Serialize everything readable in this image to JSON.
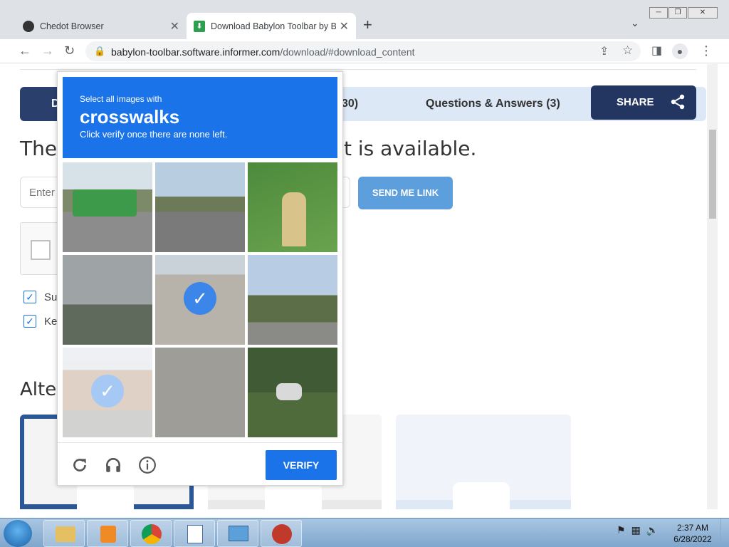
{
  "browser": {
    "tabs": [
      {
        "title": "Chedot Browser",
        "active": false
      },
      {
        "title": "Download Babylon Toolbar by Ba",
        "active": true
      }
    ],
    "url_host": "babylon-toolbar.software.informer.com",
    "url_path": "/download/#download_content"
  },
  "page": {
    "nav": {
      "left_label": "D",
      "reviews_label": "30)",
      "qa_label": "Questions & Answers (3)",
      "share_label": "SHARE"
    },
    "headline_left": "The",
    "headline_right": "t is available.",
    "email_placeholder": "Enter",
    "send_button": "SEND ME LINK",
    "checkbox_labels": [
      "Su",
      "Ke"
    ],
    "alternatives_heading": "Alter"
  },
  "captcha": {
    "instruction_top": "Select all images with",
    "target_word": "crosswalks",
    "instruction_bottom": "Click verify once there are none left.",
    "tiles": [
      {
        "subject": "green pickup truck on road",
        "selected": false
      },
      {
        "subject": "highway with cars",
        "selected": false
      },
      {
        "subject": "yellow fire hydrant on grass",
        "selected": false
      },
      {
        "subject": "freeway overpass with traffic light",
        "selected": false
      },
      {
        "subject": "street crosswalk",
        "selected": true
      },
      {
        "subject": "street with trees and pole",
        "selected": false
      },
      {
        "subject": "building at street corner",
        "selected": true,
        "fading": true
      },
      {
        "subject": "pavement with shadow",
        "selected": false
      },
      {
        "subject": "car parked near bushes",
        "selected": false
      }
    ],
    "verify_label": "VERIFY",
    "footer_icons": [
      "reload-icon",
      "audio-icon",
      "info-icon"
    ]
  },
  "taskbar": {
    "apps": [
      "explorer",
      "media-player",
      "chrome",
      "text-editor",
      "control-panel",
      "chedot"
    ],
    "time": "2:37 AM",
    "date": "6/28/2022"
  }
}
